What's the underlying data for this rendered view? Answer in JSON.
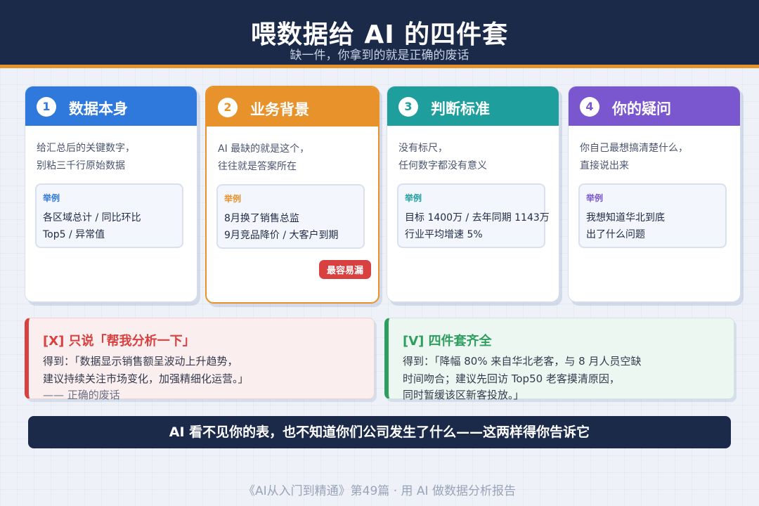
{
  "header": {
    "title": "喂数据给 AI 的四件套",
    "subtitle": "缺一件，你拿到的就是正确的废话"
  },
  "cards": [
    {
      "num": "1",
      "title": "数据本身",
      "color": "#2f78dc",
      "desc": [
        "给汇总后的关键数字，",
        "别粘三千行原始数据"
      ],
      "example_label": "举例",
      "example_lines": [
        "各区域总计 / 同比环比",
        "Top5 / 异常值"
      ]
    },
    {
      "num": "2",
      "title": "业务背景",
      "color": "#e8922c",
      "desc": [
        "AI 最缺的就是这个，",
        "往往就是答案所在"
      ],
      "example_label": "举例",
      "example_lines": [
        "8月换了销售总监",
        "9月竞品降价 / 大客户到期"
      ],
      "badge": "最容易漏"
    },
    {
      "num": "3",
      "title": "判断标准",
      "color": "#1f9e9e",
      "desc": [
        "没有标尺，",
        "任何数字都没有意义"
      ],
      "example_label": "举例",
      "example_lines": [
        "目标 1400万 / 去年同期 1143万",
        "行业平均增速 5%"
      ]
    },
    {
      "num": "4",
      "title": "你的疑问",
      "color": "#7a56cf",
      "desc": [
        "你自己最想搞清楚什么，",
        "直接说出来"
      ],
      "example_label": "举例",
      "example_lines": [
        "我想知道华北到底",
        "出了什么问题"
      ]
    }
  ],
  "bad": {
    "title": "[X]  只说「帮我分析一下」",
    "lines": [
      "得到：「数据显示销售额呈波动上升趋势，",
      "建议持续关注市场变化，加强精细化运营。」",
      "—— 正确的废话"
    ]
  },
  "good": {
    "title": "[V]  四件套齐全",
    "lines": [
      "得到：「降幅 80% 来自华北老客，与 8 月人员空缺",
      "时间吻合；建议先回访 Top50 老客摸清原因，",
      "同时暂缓该区新客投放。」"
    ]
  },
  "banner": "AI 看不见你的表，也不知道你们公司发生了什么——这两样得你告诉它",
  "footer": "《AI从入门到精通》第49篇 · 用 AI 做数据分析报告"
}
